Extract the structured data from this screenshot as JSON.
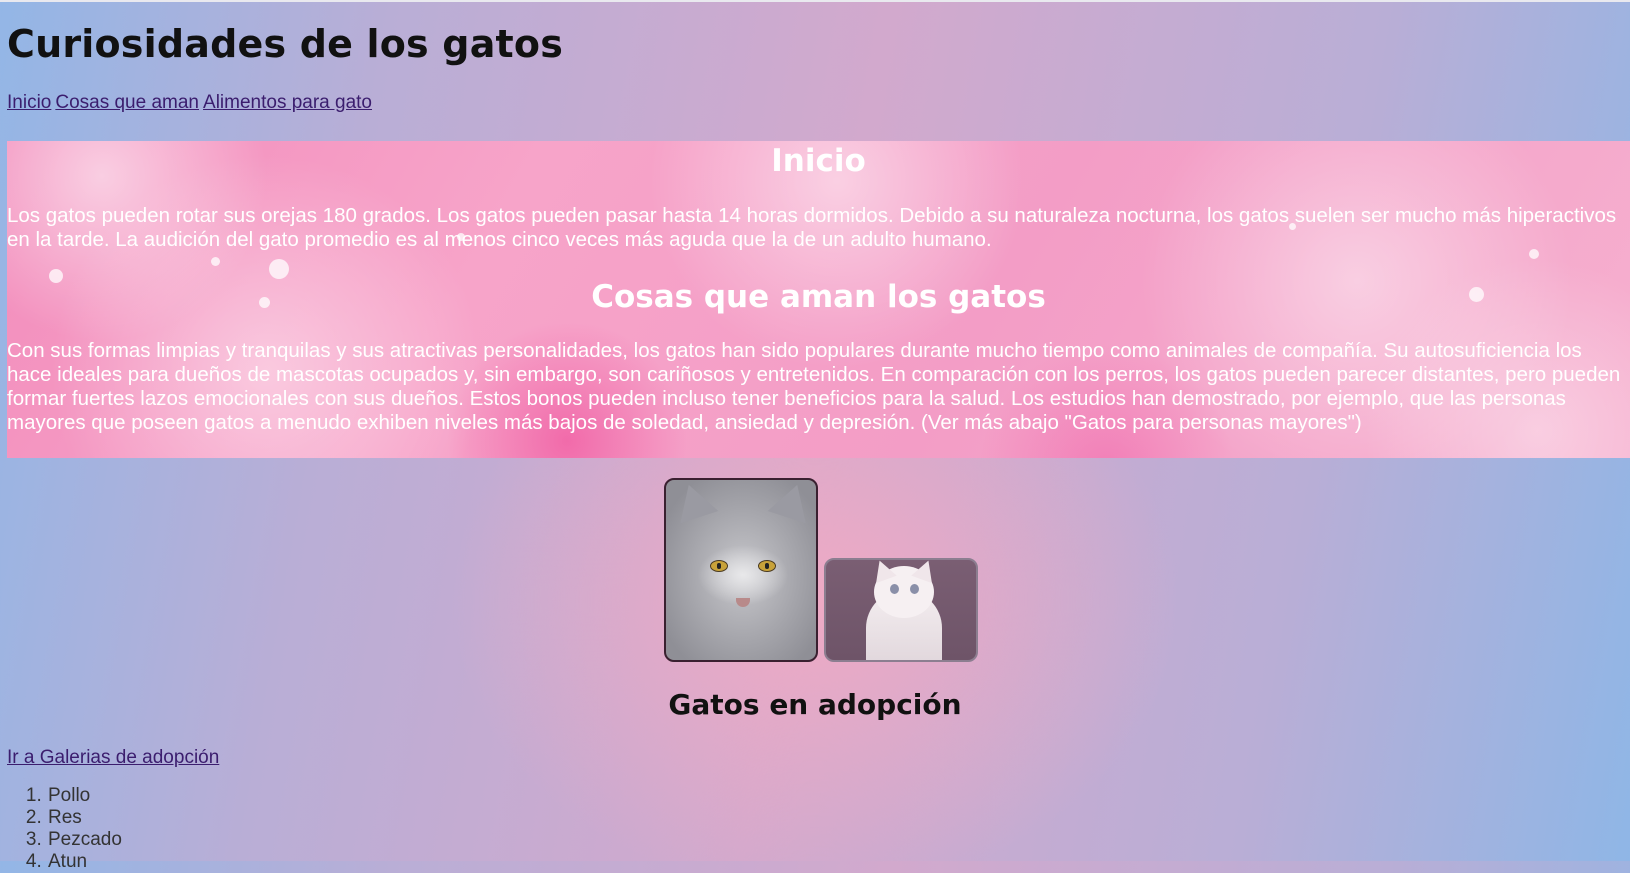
{
  "page": {
    "title": "Curiosidades de los gatos"
  },
  "nav": {
    "items": [
      {
        "label": "Inicio"
      },
      {
        "label": "Cosas que aman"
      },
      {
        "label": "Alimentos para gato"
      }
    ]
  },
  "hero": {
    "inicio_heading": "Inicio",
    "inicio_text": "Los gatos pueden rotar sus orejas 180 grados. Los gatos pueden pasar hasta 14 horas dormidos. Debido a su naturaleza nocturna, los gatos suelen ser mucho más hiperactivos en la tarde. La audición del gato promedio es al menos cinco veces más aguda que la de un adulto humano.",
    "cosas_heading": "Cosas que aman los gatos",
    "cosas_text": "Con sus formas limpias y tranquilas y sus atractivas personalidades, los gatos han sido populares durante mucho tiempo como animales de compañía. Su autosuficiencia los hace ideales para dueños de mascotas ocupados y, sin embargo, son cariñosos y entretenidos. En comparación con los perros, los gatos pueden parecer distantes, pero pueden formar fuertes lazos emocionales con sus dueños. Estos bonos pueden incluso tener beneficios para la salud. Los estudios han demostrado, por ejemplo, que las personas mayores que poseen gatos a menudo exhiben niveles más bajos de soledad, ansiedad y depresión. (Ver más abajo \"Gatos para personas mayores\")"
  },
  "adoption": {
    "heading": "Gatos en adopción",
    "link_label": "Ir a Galerias de adopción"
  },
  "food_list": {
    "items": [
      "Pollo",
      "Res",
      "Pezcado",
      "Atun"
    ]
  },
  "colors": {
    "link": "#3b1d6e",
    "hero_text": "#ffffff"
  }
}
